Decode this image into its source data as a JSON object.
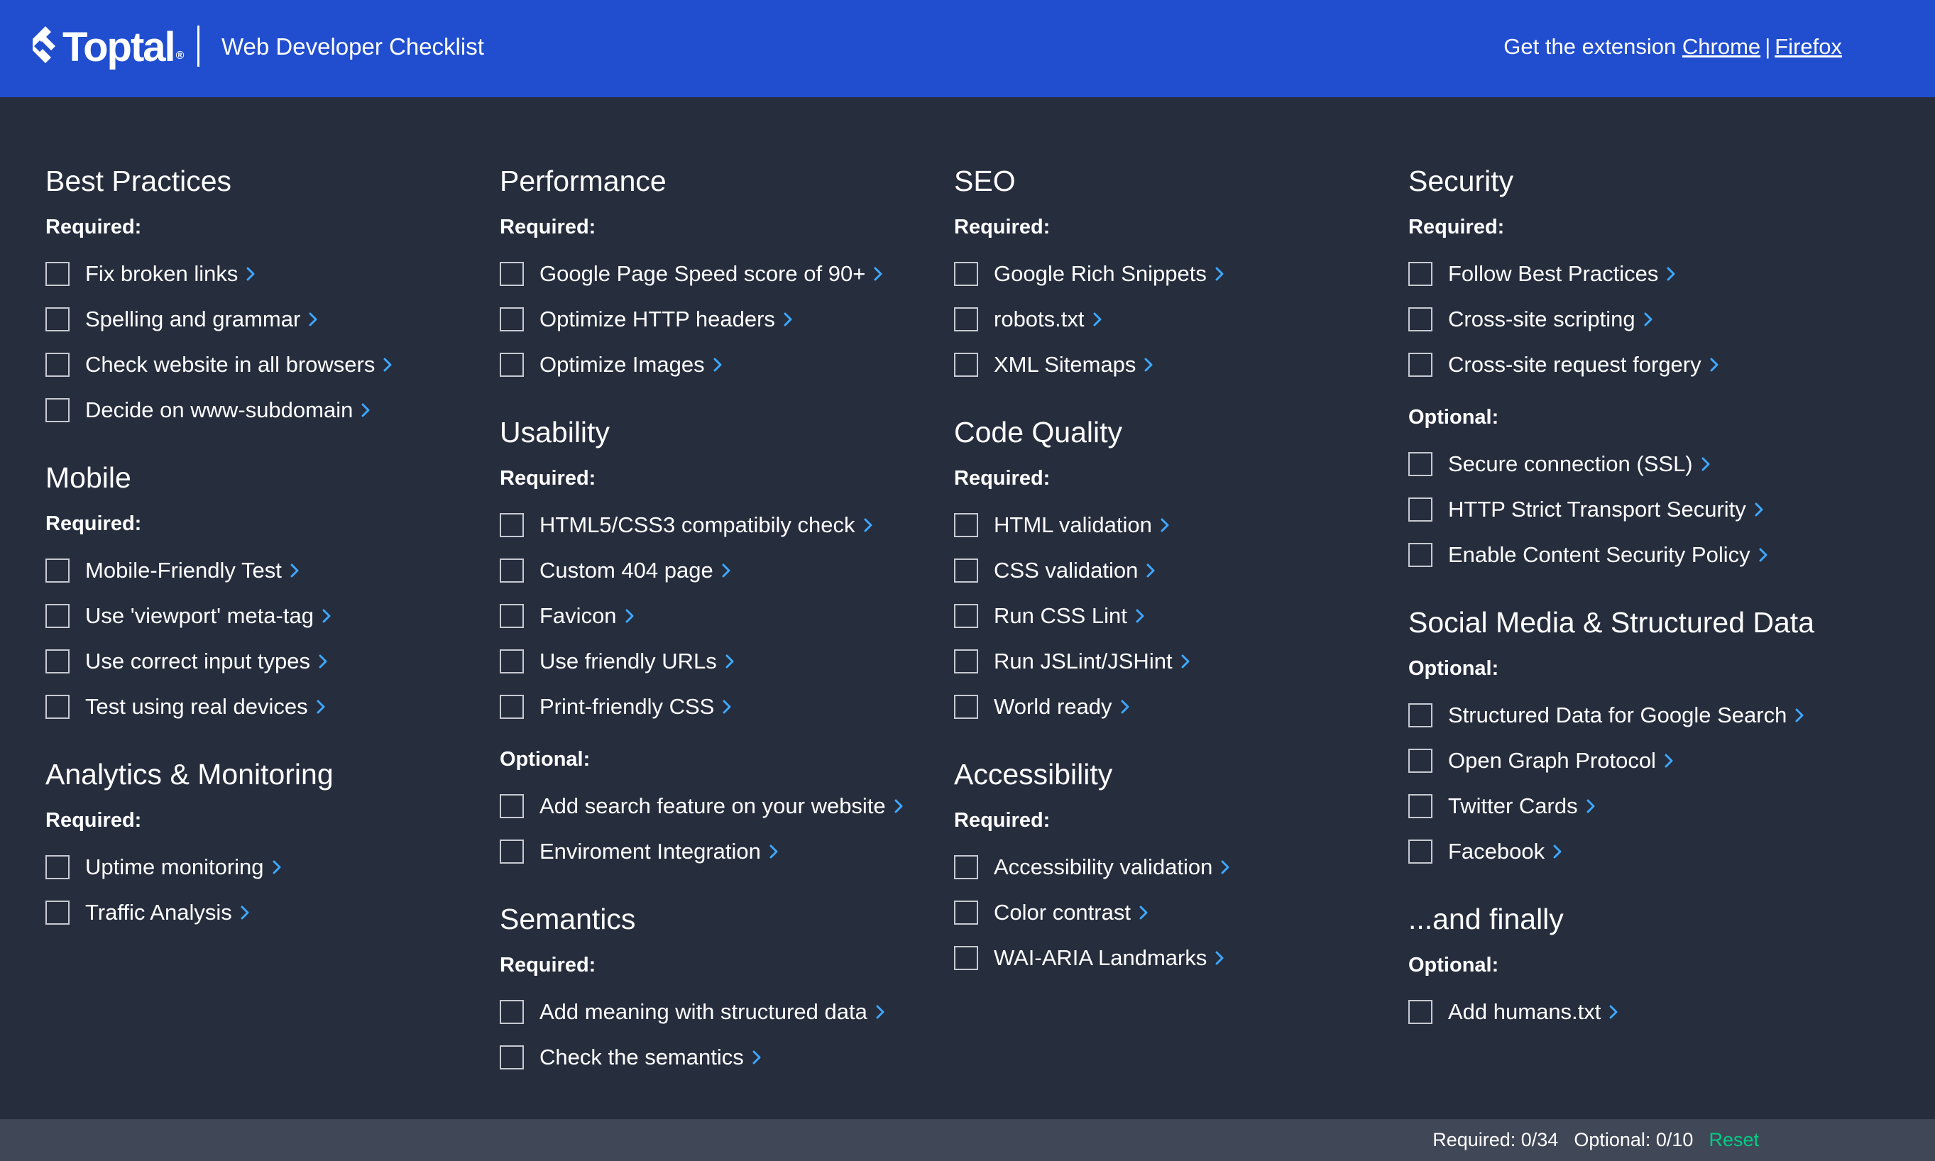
{
  "header": {
    "logo_text": "Toptal",
    "logo_reg": "®",
    "title": "Web Developer Checklist",
    "extension_prompt": "Get the extension",
    "chrome_link": "Chrome",
    "separator": "|",
    "firefox_link": "Firefox"
  },
  "colors": {
    "header_bg": "#204ecf",
    "page_bg": "#262d3d",
    "footer_bg": "#404757",
    "chevron": "#3ea8ff",
    "reset": "#00cc83"
  },
  "icons": {
    "logo": "toptal-logo-icon",
    "item_checkbox": "checkbox-icon",
    "item_arrow": "chevron-right-icon"
  },
  "columns": [
    {
      "sections": [
        {
          "title": "Best Practices",
          "groups": [
            {
              "label": "Required:",
              "items": [
                "Fix broken links",
                "Spelling and grammar",
                "Check website in all browsers",
                "Decide on www-subdomain"
              ]
            }
          ]
        },
        {
          "title": "Mobile",
          "groups": [
            {
              "label": "Required:",
              "items": [
                "Mobile-Friendly Test",
                "Use 'viewport' meta-tag",
                "Use correct input types",
                "Test using real devices"
              ]
            }
          ]
        },
        {
          "title": "Analytics & Monitoring",
          "groups": [
            {
              "label": "Required:",
              "items": [
                "Uptime monitoring",
                "Traffic Analysis"
              ]
            }
          ]
        }
      ]
    },
    {
      "sections": [
        {
          "title": "Performance",
          "groups": [
            {
              "label": "Required:",
              "items": [
                "Google Page Speed score of 90+",
                "Optimize HTTP headers",
                "Optimize Images"
              ]
            }
          ]
        },
        {
          "title": "Usability",
          "groups": [
            {
              "label": "Required:",
              "items": [
                "HTML5/CSS3 compatibily check",
                "Custom 404 page",
                "Favicon",
                "Use friendly URLs",
                "Print-friendly CSS"
              ]
            },
            {
              "label": "Optional:",
              "items": [
                "Add search feature on your website",
                "Enviroment Integration"
              ]
            }
          ]
        },
        {
          "title": "Semantics",
          "groups": [
            {
              "label": "Required:",
              "items": [
                "Add meaning with structured data",
                "Check the semantics"
              ]
            }
          ]
        }
      ]
    },
    {
      "sections": [
        {
          "title": "SEO",
          "groups": [
            {
              "label": "Required:",
              "items": [
                "Google Rich Snippets",
                "robots.txt",
                "XML Sitemaps"
              ]
            }
          ]
        },
        {
          "title": "Code Quality",
          "groups": [
            {
              "label": "Required:",
              "items": [
                "HTML validation",
                "CSS validation",
                "Run CSS Lint",
                "Run JSLint/JSHint",
                "World ready"
              ]
            }
          ]
        },
        {
          "title": "Accessibility",
          "groups": [
            {
              "label": "Required:",
              "items": [
                "Accessibility validation",
                "Color contrast",
                "WAI-ARIA Landmarks"
              ]
            }
          ]
        }
      ]
    },
    {
      "sections": [
        {
          "title": "Security",
          "groups": [
            {
              "label": "Required:",
              "items": [
                "Follow Best Practices",
                "Cross-site scripting",
                "Cross-site request forgery"
              ]
            },
            {
              "label": "Optional:",
              "items": [
                "Secure connection (SSL)",
                "HTTP Strict Transport Security",
                "Enable Content Security Policy"
              ]
            }
          ]
        },
        {
          "title": "Social Media & Structured Data",
          "groups": [
            {
              "label": "Optional:",
              "items": [
                "Structured Data for Google Search",
                "Open Graph Protocol",
                "Twitter Cards",
                "Facebook"
              ]
            }
          ]
        },
        {
          "title": "...and finally",
          "groups": [
            {
              "label": "Optional:",
              "items": [
                "Add humans.txt"
              ]
            }
          ]
        }
      ]
    }
  ],
  "footer": {
    "required_progress": "Required: 0/34",
    "optional_progress": "Optional: 0/10",
    "reset_label": "Reset"
  }
}
